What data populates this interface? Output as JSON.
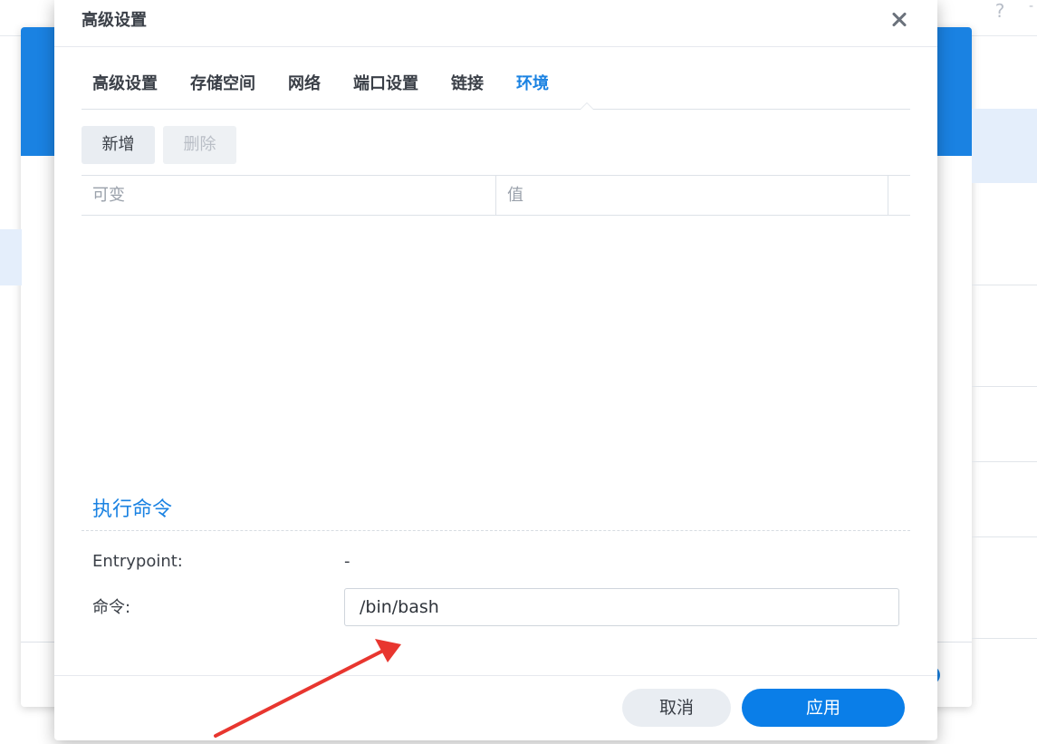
{
  "background": {
    "help_glyph": "?",
    "dash_glyph": "-"
  },
  "dialog": {
    "title": "高级设置",
    "close_icon": "close-icon",
    "tabs": [
      {
        "label": "高级设置"
      },
      {
        "label": "存储空间"
      },
      {
        "label": "网络"
      },
      {
        "label": "端口设置"
      },
      {
        "label": "链接"
      },
      {
        "label": "环境",
        "active": true
      }
    ],
    "toolbar": {
      "add_label": "新增",
      "delete_label": "删除"
    },
    "env_table": {
      "columns": [
        "可变",
        "值"
      ]
    },
    "command_section": {
      "title": "执行命令",
      "entrypoint_label": "Entrypoint:",
      "entrypoint_value": "-",
      "command_label": "命令:",
      "command_value": "/bin/bash"
    },
    "footer": {
      "cancel_label": "取消",
      "apply_label": "应用"
    }
  },
  "colors": {
    "accent": "#1a82e2",
    "apply_button": "#0a7ee8",
    "annotation_arrow": "#e8362f"
  }
}
